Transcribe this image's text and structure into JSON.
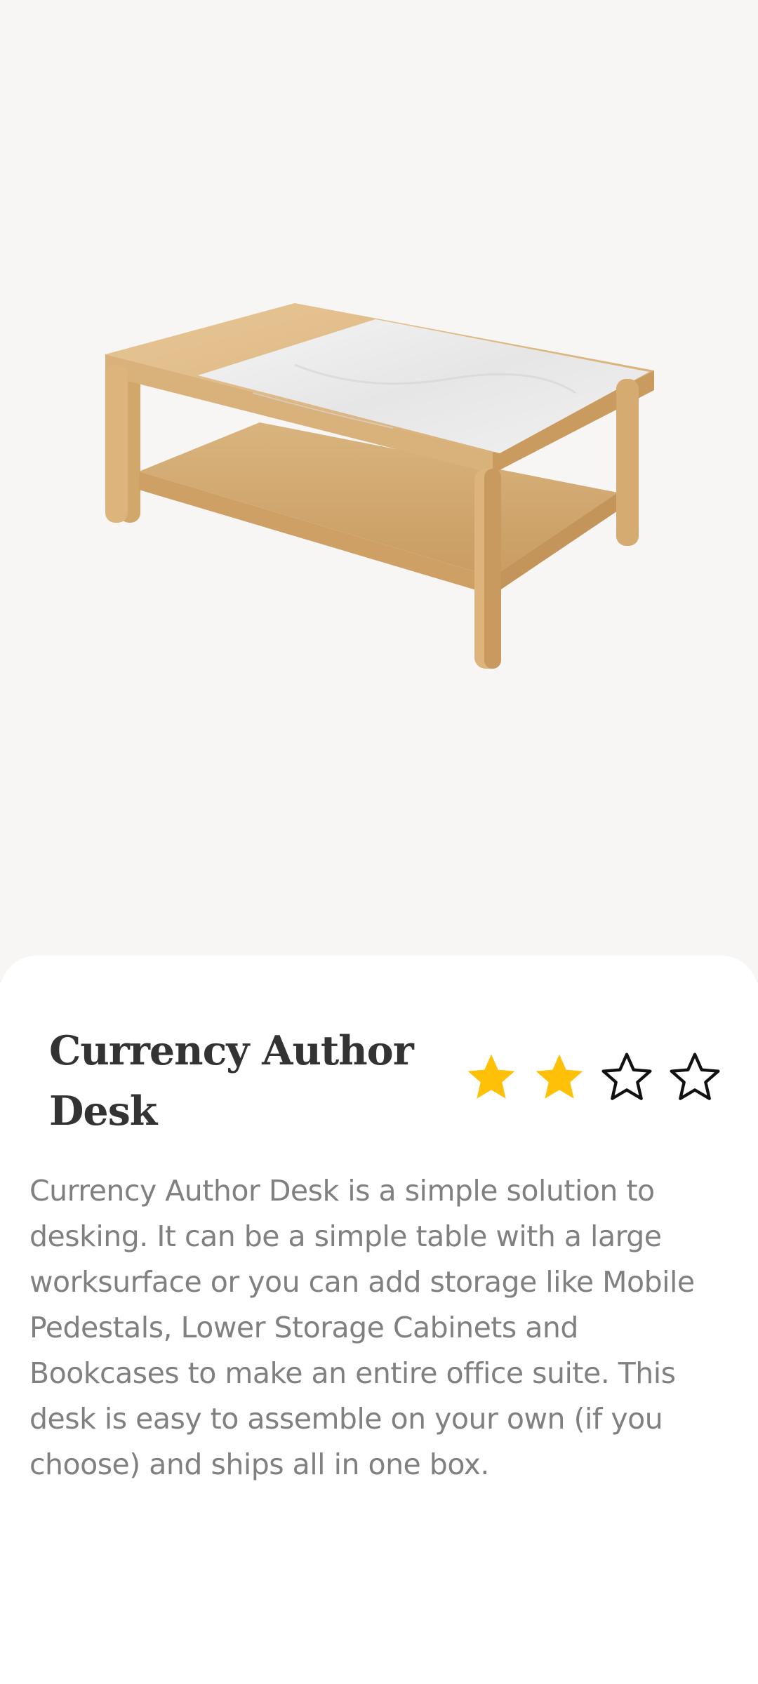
{
  "product": {
    "image_icon": "coffee-table-image",
    "title": "Currency Author Desk",
    "rating": {
      "value": 2,
      "max": 4
    },
    "description": "Currency Author Desk is a simple solution to desking. It can be a simple table with a large worksurface or you can add storage like Mobile Pedestals, Lower Storage Cabinets and Bookcases to make an entire office suite. This desk is easy to assemble on your own (if you choose) and ships all in one box."
  },
  "colors": {
    "hero_background": "#f7f6f4",
    "star_filled": "#FFC107",
    "star_outline": "#111111",
    "title": "#333333",
    "description": "#808080"
  }
}
